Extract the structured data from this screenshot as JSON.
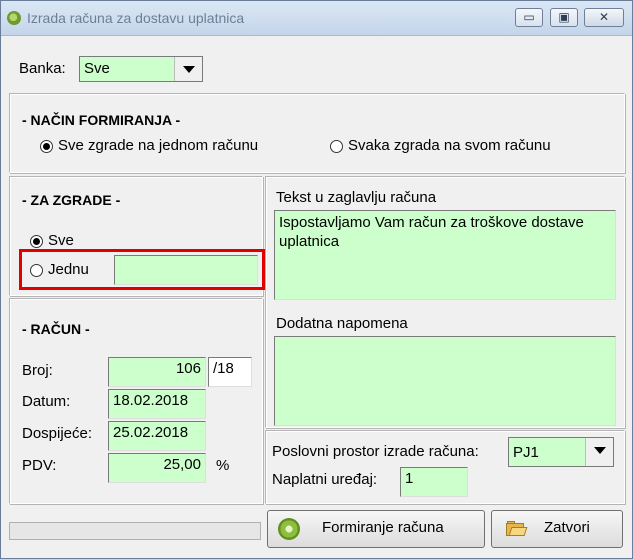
{
  "window": {
    "title": "Izrada računa za dostavu uplatnica",
    "controls": {
      "minimize": "▭",
      "maximize": "▣",
      "close": "✕"
    }
  },
  "banka": {
    "label": "Banka:",
    "value": "Sve"
  },
  "nacin": {
    "header": "- NAČIN FORMIRANJA -",
    "option1": "Sve zgrade na jednom računu",
    "option2": "Svaka zgrada na svom računu",
    "selected": "option1"
  },
  "za_zgrade": {
    "header": "- ZA ZGRADE -",
    "option_sve": "Sve",
    "option_jednu": "Jednu",
    "jednu_value": "",
    "selected": "option_sve"
  },
  "racun": {
    "header": "- RAČUN -",
    "broj_label": "Broj:",
    "broj_value": "106",
    "broj_suffix": "/18",
    "datum_label": "Datum:",
    "datum_value": "18.02.2018",
    "dospijece_label": "Dospijeće:",
    "dospijece_value": "25.02.2018",
    "pdv_label": "PDV:",
    "pdv_value": "25,00",
    "pdv_unit": "%"
  },
  "tekst": {
    "label": "Tekst u zaglavlju računa",
    "value": "Ispostavljamo Vam račun za troškove dostave uplatnica"
  },
  "napomena": {
    "label": "Dodatna napomena",
    "value": ""
  },
  "poslovni": {
    "label": "Poslovni prostor izrade računa:",
    "value": "PJ1",
    "uredaj_label": "Naplatni uređaj:",
    "uredaj_value": "1"
  },
  "progress": {
    "value": 0
  },
  "buttons": {
    "formiranje": "Formiranje računa",
    "zatvori": "Zatvori"
  },
  "colors": {
    "field_bg": "#ccffcc",
    "highlight": "#e00000"
  }
}
